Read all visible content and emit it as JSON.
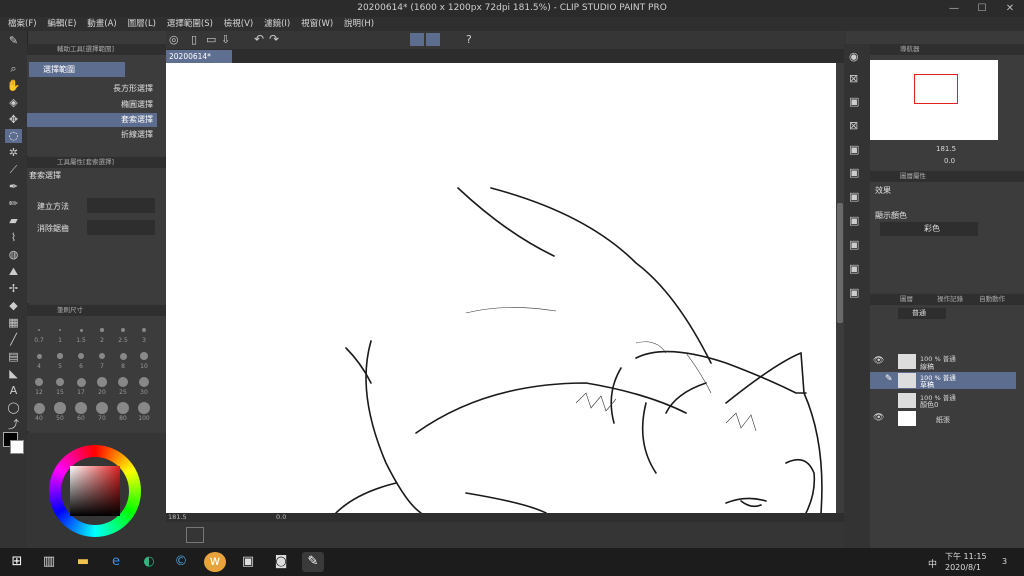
{
  "window": {
    "title": "20200614* (1600 x 1200px 72dpi 181.5%) - CLIP STUDIO PAINT PRO",
    "min": "—",
    "max": "☐",
    "close": "✕"
  },
  "menu": [
    "檔案(F)",
    "編輯(E)",
    "動畫(A)",
    "圖層(L)",
    "選擇範圍(S)",
    "檢視(V)",
    "濾鏡(I)",
    "視窗(W)",
    "說明(H)"
  ],
  "subtool_panel": {
    "title": "輔助工具[選擇範圍]",
    "group": "選擇範圍",
    "items": [
      {
        "label": "長方形選擇",
        "selected": false
      },
      {
        "label": "橢圓選擇",
        "selected": false
      },
      {
        "label": "套索選擇",
        "selected": true
      },
      {
        "label": "折線選擇",
        "selected": false
      }
    ]
  },
  "tool_property": {
    "title": "工具屬性[套索選擇]",
    "name": "套索選擇",
    "rows": [
      {
        "label": "建立方法"
      },
      {
        "label": "消除鋸齒"
      }
    ]
  },
  "brush_size": {
    "title": "筆刷尺寸",
    "sizes": [
      "0.7",
      "1",
      "1.5",
      "2",
      "2.5",
      "3",
      "4",
      "5",
      "6",
      "7",
      "8",
      "10",
      "12",
      "15",
      "17",
      "20",
      "25",
      "30",
      "40",
      "50",
      "60",
      "70",
      "80",
      "100"
    ]
  },
  "document": {
    "tab": "20200614*",
    "zoom_status": "181.5",
    "rotation_status": "0.0"
  },
  "navigator": {
    "tabs": [
      "導航器",
      "",
      ""
    ],
    "zoom": "181.5",
    "rotation": "0.0"
  },
  "layer_property": {
    "tabs": [
      "圖層屬性",
      ""
    ],
    "effect_label": "效果",
    "display_color_label": "顯示顏色",
    "display_color_value": "彩色"
  },
  "layers_panel": {
    "tabs": [
      "圖層",
      "操作記錄",
      "自動動作"
    ],
    "blend_mode": "普通",
    "layers": [
      {
        "line1": "100 % 普通",
        "line2": "線稿",
        "selected": false,
        "visible": true
      },
      {
        "line1": "100 % 普通",
        "line2": "草稿",
        "selected": true,
        "visible": false
      },
      {
        "line1": "100 % 普通",
        "line2": "顏色0",
        "selected": false,
        "visible": false
      },
      {
        "line1": "",
        "line2": "紙張",
        "selected": false,
        "visible": true
      }
    ]
  },
  "taskbar": {
    "time": "下午 11:15",
    "date": "2020/8/1",
    "ime": "中",
    "notification_count": "3"
  },
  "colors": {
    "accent": "#5d6d8f",
    "panel": "#3c3c3c",
    "canvas": "#ffffff"
  }
}
